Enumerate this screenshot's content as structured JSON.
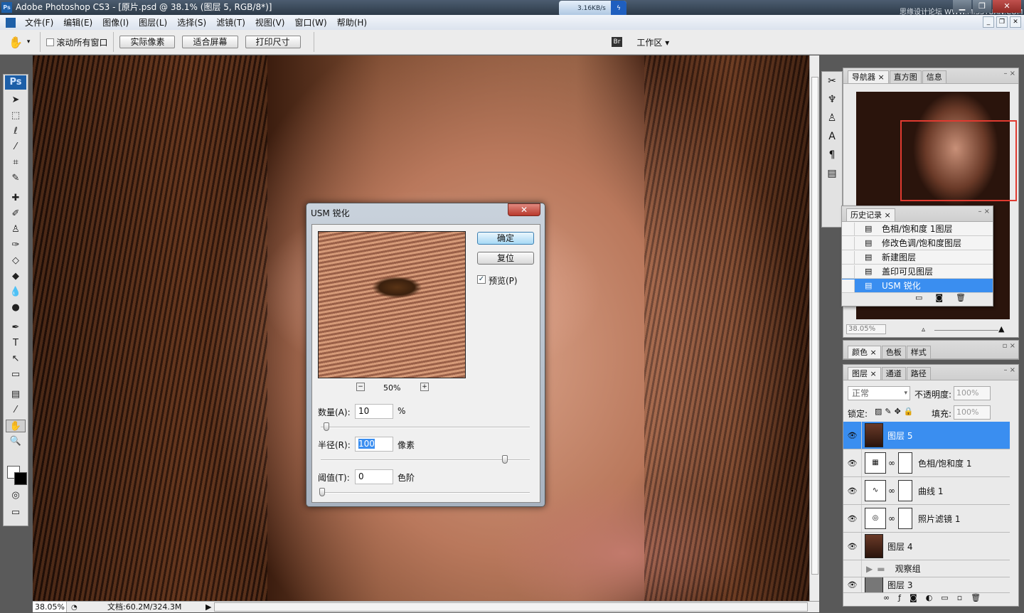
{
  "title": "Adobe Photoshop CS3 - [原片.psd @ 38.1% (图层 5, RGB/8*)]",
  "app_badge": "Ps",
  "speed": "3.16KB/s",
  "watermark": "思缘设计论坛 WWW.MISSYUAN.COM",
  "menu": [
    "文件(F)",
    "编辑(E)",
    "图像(I)",
    "图层(L)",
    "选择(S)",
    "滤镜(T)",
    "视图(V)",
    "窗口(W)",
    "帮助(H)"
  ],
  "options": {
    "scroll_all": "滚动所有窗口",
    "actual_pixels": "实际像素",
    "fit_screen": "适合屏幕",
    "print_size": "打印尺寸",
    "workspace": "工作区 ▾",
    "bridge": "Br"
  },
  "toolbox": {
    "logo": "Ps"
  },
  "status": {
    "zoom": "38.05%",
    "doc": "文档:60.2M/324.3M"
  },
  "navigator": {
    "tabs": [
      "导航器",
      "直方图",
      "信息"
    ],
    "zoom": "38.05%"
  },
  "history": {
    "tab": "历史记录",
    "items": [
      "色相/饱和度 1图层",
      "修改色调/饱和度图层",
      "新建图层",
      "盖印可见图层",
      "USM 锐化"
    ],
    "selected": 4
  },
  "color_panel": {
    "tabs": [
      "颜色",
      "色板",
      "样式"
    ]
  },
  "layers": {
    "tabs": [
      "图层",
      "通道",
      "路径"
    ],
    "blend": "正常",
    "opacity_label": "不透明度:",
    "opacity": "100%",
    "lock_label": "锁定:",
    "fill_label": "填充:",
    "fill": "100%",
    "items": [
      {
        "name": "图层 5",
        "type": "pixel",
        "visible": true,
        "selected": true
      },
      {
        "name": "色相/饱和度 1",
        "type": "adjust",
        "visible": true
      },
      {
        "name": "曲线 1",
        "type": "adjust",
        "visible": true
      },
      {
        "name": "照片滤镜 1",
        "type": "adjust",
        "visible": true
      },
      {
        "name": "图层 4",
        "type": "pixel",
        "visible": true
      },
      {
        "name": "观察组",
        "type": "group",
        "visible": false
      },
      {
        "name": "图层 3",
        "type": "pixel",
        "visible": true
      }
    ]
  },
  "dialog": {
    "title": "USM 锐化",
    "ok": "确定",
    "reset": "复位",
    "preview_label": "预览(P)",
    "preview_checked": true,
    "zoom": "50%",
    "amount_label": "数量(A):",
    "amount": "10",
    "amount_unit": "%",
    "amount_slider": 0.02,
    "radius_label": "半径(R):",
    "radius": "100",
    "radius_unit": "像素",
    "radius_slider": 0.9,
    "threshold_label": "阈值(T):",
    "threshold": "0",
    "threshold_unit": "色阶",
    "threshold_slider": 0
  }
}
